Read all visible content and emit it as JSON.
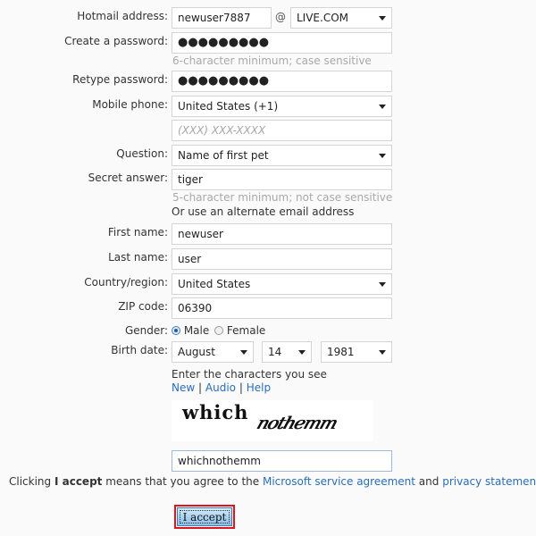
{
  "form": {
    "hotmail": {
      "label": "Hotmail address:",
      "value": "newuser7887",
      "at": "@",
      "domain": "LIVE.COM"
    },
    "password": {
      "label": "Create a password:",
      "value": "●●●●●●●●●",
      "hint": "6-character minimum; case sensitive"
    },
    "retype": {
      "label": "Retype password:",
      "value": "●●●●●●●●●"
    },
    "mobile": {
      "label": "Mobile phone:",
      "country": "United States (+1)",
      "placeholder": "(XXX) XXX-XXXX"
    },
    "question": {
      "label": "Question:",
      "value": "Name of first pet"
    },
    "secret": {
      "label": "Secret answer:",
      "value": "tiger",
      "hint": "5-character minimum; not case sensitive",
      "alt_link": "Or use an alternate email address"
    },
    "first_name": {
      "label": "First name:",
      "value": "newuser"
    },
    "last_name": {
      "label": "Last name:",
      "value": "user"
    },
    "country": {
      "label": "Country/region:",
      "value": "United States"
    },
    "zip": {
      "label": "ZIP code:",
      "value": "06390"
    },
    "gender": {
      "label": "Gender:",
      "options": [
        "Male",
        "Female"
      ],
      "selected": "Male"
    },
    "birth": {
      "label": "Birth date:",
      "month": "August",
      "day": "14",
      "year": "1981"
    },
    "captcha": {
      "prompt": "Enter the characters you see",
      "links": [
        "New",
        "Audio",
        "Help"
      ],
      "separator": "|",
      "image_words": [
        "which",
        "nothemm"
      ],
      "value": "whichnothemm"
    }
  },
  "agreement": {
    "prefix": "Clicking ",
    "bold": "I accept",
    "middle": " means that you agree to the ",
    "link1": "Microsoft service agreement",
    "and": " and ",
    "link2": "privacy statement",
    "suffix": "."
  },
  "accept_button": {
    "label": "I accept",
    "highlight_color": "#e0141d"
  }
}
